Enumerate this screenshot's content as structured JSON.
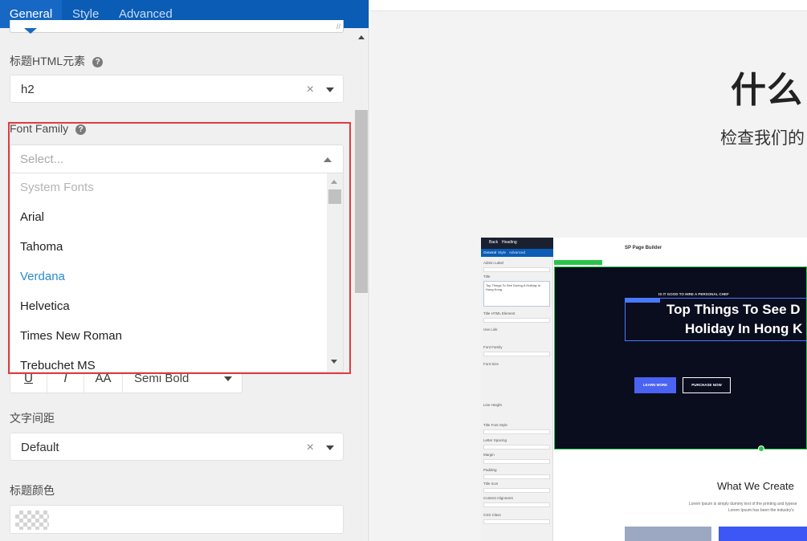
{
  "tabs": [
    {
      "label": "General",
      "active": true
    },
    {
      "label": "Style",
      "active": false
    },
    {
      "label": "Advanced",
      "active": false
    }
  ],
  "fields": {
    "heading_html_element": {
      "label": "标题HTML元素",
      "value": "h2"
    },
    "font_family": {
      "label": "Font Family",
      "placeholder": "Select...",
      "options_group": "System Fonts",
      "options": [
        "Arial",
        "Tahoma",
        "Verdana",
        "Helvetica",
        "Times New Roman",
        "Trebuchet MS"
      ],
      "highlighted": "Verdana"
    },
    "font_style": {
      "buttons": [
        "U",
        "I",
        "AA"
      ],
      "weight": "Semi Bold"
    },
    "letter_spacing": {
      "label": "文字间距",
      "value": "Default"
    },
    "heading_color": {
      "label": "标题颜色"
    }
  },
  "icons": {
    "help": "?",
    "clear": "×",
    "resize": "//"
  },
  "colors": {
    "accent": "#0a5cb5",
    "highlight_option": "#2a8ad1",
    "callout": "#e03c3c"
  },
  "preview": {
    "hero_title": "什么",
    "hero_subtitle": "检查我们的",
    "mini": {
      "header_a": "Back",
      "header_b": "Heading",
      "tabs": [
        "General",
        "Style",
        "Advanced"
      ],
      "labels": [
        "Admin Label",
        "Title",
        "Title HTML Element",
        "Use Link",
        "Font Family",
        "Font Size",
        "Line Height",
        "Title Font Style",
        "Letter Spacing",
        "Margin",
        "Padding",
        "Title Icon",
        "Content Alignment",
        "CSS Class"
      ],
      "title_value": "Top Things To See During A Holiday In Hong Kong",
      "logo": "SP Page Builder",
      "kicker": "IS IT GOOD TO HIRE A PERSONAL CHEF",
      "headline_1": "Top Things To See D",
      "headline_2": "Holiday In Hong K",
      "btn_primary": "LEARN MORE",
      "btn_secondary": "PURCHASE NOW",
      "section_title": "What We Create",
      "section_text_1": "Lorem Ipsum is simply dummy text of the printing and typese",
      "section_text_2": "Lorem Ipsum has been the industry's"
    }
  }
}
